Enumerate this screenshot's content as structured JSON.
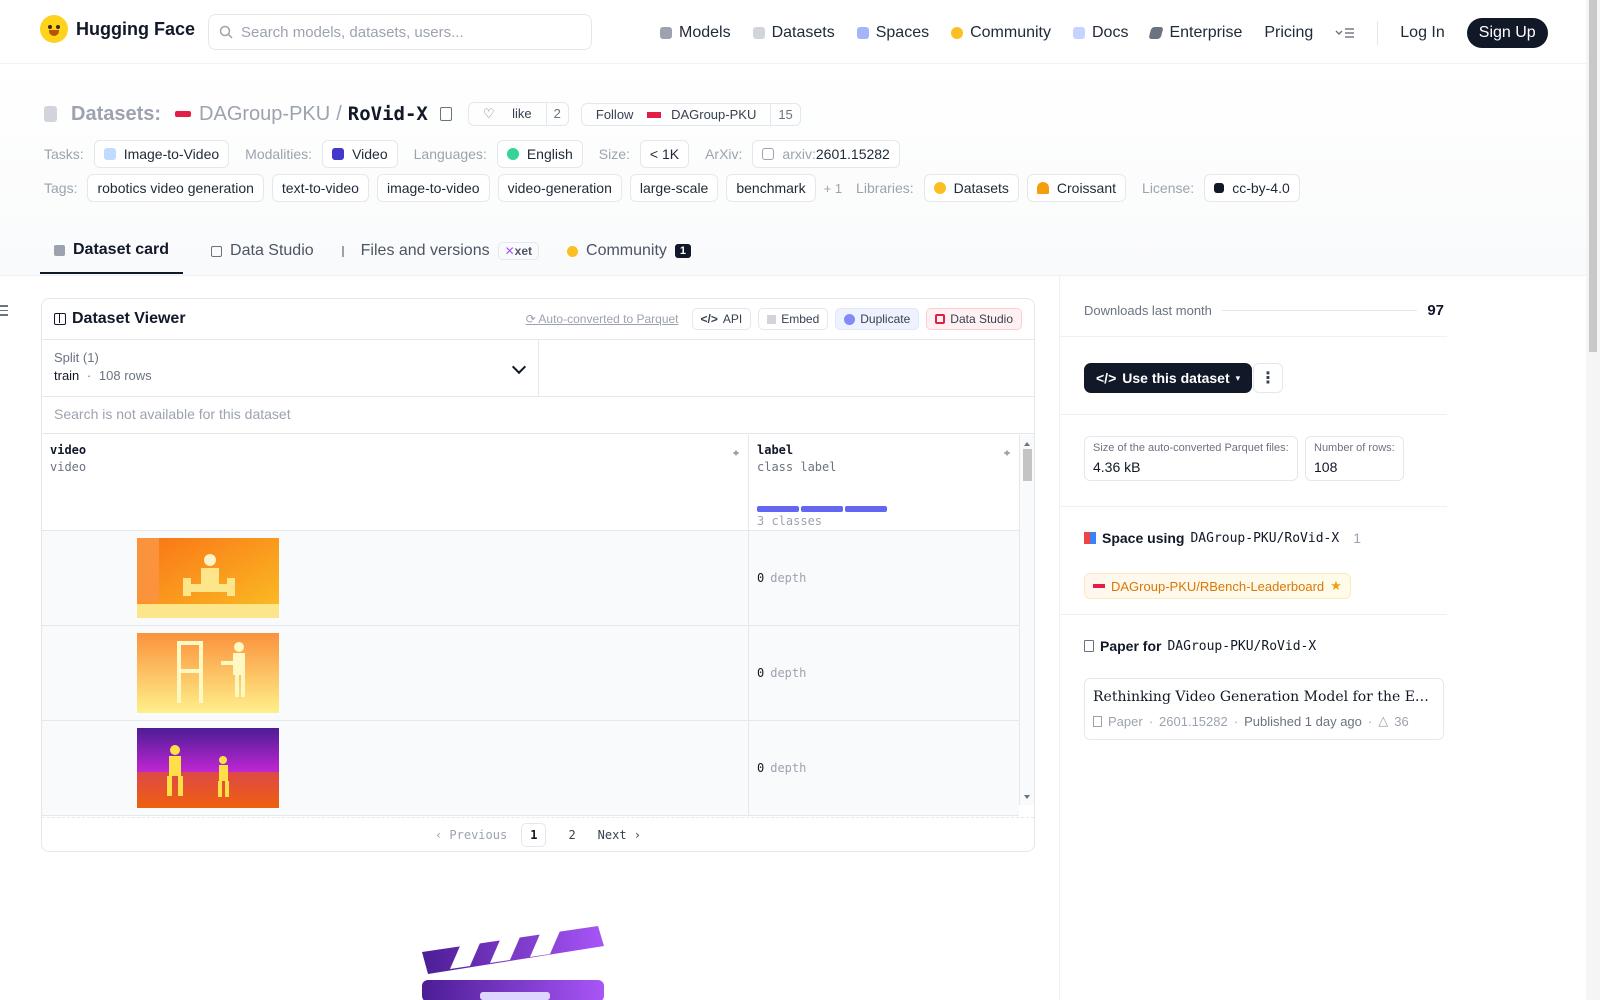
{
  "header": {
    "brand": "Hugging Face",
    "search_placeholder": "Search models, datasets, users...",
    "nav": [
      {
        "label": "Models",
        "icon": "cube-icon",
        "color": "#9ca3af"
      },
      {
        "label": "Datasets",
        "icon": "database-icon",
        "color": "#d1d5db"
      },
      {
        "label": "Spaces",
        "icon": "spaces-icon",
        "color": "#a5b4fc"
      },
      {
        "label": "Community",
        "icon": "hug-icon",
        "color": "#fbbf24"
      },
      {
        "label": "Docs",
        "icon": "book-icon",
        "color": "#c7d2fe"
      },
      {
        "label": "Enterprise",
        "icon": "enterprise-icon",
        "color": "#6b7280"
      },
      {
        "label": "Pricing",
        "icon": "",
        "color": ""
      }
    ],
    "login": "Log In",
    "signup": "Sign Up"
  },
  "repo": {
    "section": "Datasets:",
    "org": "DAGroup-PKU",
    "slash": "/",
    "name": "RoVid-X",
    "like_label": "like",
    "like_count": "2",
    "follow_label": "Follow",
    "follow_org": "DAGroup-PKU",
    "follow_count": "15"
  },
  "meta": {
    "tasks_label": "Tasks:",
    "task": "Image-to-Video",
    "modalities_label": "Modalities:",
    "modality": "Video",
    "languages_label": "Languages:",
    "language": "English",
    "size_label": "Size:",
    "size": "< 1K",
    "arxiv_label": "ArXiv:",
    "arxiv_prefix": "arxiv:",
    "arxiv_id": "2601.15282",
    "tags_label": "Tags:",
    "tags": [
      "robotics video generation",
      "text-to-video",
      "image-to-video",
      "video-generation",
      "large-scale",
      "benchmark"
    ],
    "tags_more": "+ 1",
    "libraries_label": "Libraries:",
    "libraries": [
      "Datasets",
      "Croissant"
    ],
    "license_label": "License:",
    "license": "cc-by-4.0"
  },
  "tabs": [
    {
      "label": "Dataset card",
      "icon": "cube-icon"
    },
    {
      "label": "Data Studio",
      "icon": "table-icon"
    },
    {
      "label": "Files and versions",
      "icon": "files-icon",
      "badge": "xet"
    },
    {
      "label": "Community",
      "icon": "hug-icon",
      "count": "1"
    }
  ],
  "viewer": {
    "title": "Dataset Viewer",
    "auto_converted": "Auto-converted to Parquet",
    "api": "API",
    "embed": "Embed",
    "duplicate": "Duplicate",
    "data_studio": "Data Studio",
    "split_label": "Split (1)",
    "split_name": "train",
    "split_dot": "·",
    "split_rows": "108 rows",
    "search_unavailable": "Search is not available for this dataset",
    "columns": [
      {
        "name": "video",
        "type": "video"
      },
      {
        "name": "label",
        "type": "class label",
        "classes": "3 classes"
      }
    ],
    "rows": [
      {
        "value": "0",
        "label": "depth",
        "thumb": "warm"
      },
      {
        "value": "0",
        "label": "depth",
        "thumb": "yellow"
      },
      {
        "value": "0",
        "label": "depth",
        "thumb": "purple"
      }
    ],
    "pager": {
      "prev": "Previous",
      "pages": [
        "1",
        "2"
      ],
      "current": "1",
      "next": "Next"
    }
  },
  "sidebar": {
    "downloads_label": "Downloads last month",
    "downloads": "97",
    "use_dataset": "Use this dataset",
    "parquet_size_label": "Size of the auto-converted Parquet files:",
    "parquet_size": "4.36 kB",
    "num_rows_label": "Number of rows:",
    "num_rows": "108",
    "space_using_label": "Space using",
    "space_using_repo": "DAGroup-PKU/RoVid-X",
    "space_count": "1",
    "space_name": "DAGroup-PKU/RBench-Leaderboard",
    "paper_for_label": "Paper for",
    "paper_for_repo": "DAGroup-PKU/RoVid-X",
    "paper_title": "Rethinking Video Generation Model for the Embodied World",
    "paper_kind": "Paper",
    "paper_id": "2601.15282",
    "paper_published": "Published 1 day ago",
    "paper_upvotes": "36"
  },
  "colors": {
    "accent_dark": "#111827",
    "class_bar": "#6366f1",
    "space_pill": "#d97706"
  }
}
